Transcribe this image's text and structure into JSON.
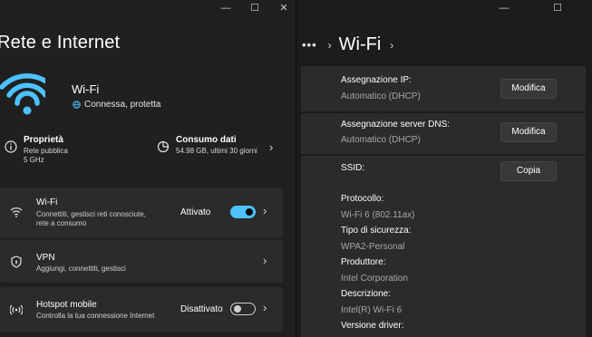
{
  "window_controls": {
    "minimize": "—",
    "maximize": "☐",
    "close": "✕"
  },
  "left": {
    "title": "Rete e Internet",
    "hero": {
      "name": "Wi-Fi",
      "status": "Connessa, protetta",
      "icon": "wifi-icon"
    },
    "properties": {
      "title": "Proprietà",
      "line1": "Rete pubblica",
      "line2": "5 GHz",
      "icon": "info-icon"
    },
    "data_usage": {
      "title": "Consumo dati",
      "subtitle": "54.98 GB, ultimi 30 giorni",
      "icon": "pie-chart-icon"
    },
    "items": [
      {
        "title": "Wi-Fi",
        "desc_line1": "Connettiti, gestisci reti conosciute,",
        "desc_line2": "rete a consumo",
        "state": "Attivato",
        "toggle_on": true,
        "icon": "wifi-icon"
      },
      {
        "title": "VPN",
        "desc_line1": "Aggiungi, connettiti, gestisci",
        "icon": "shield-icon"
      },
      {
        "title": "Hotspot mobile",
        "desc_line1": "Controlla la tua connessione Internet",
        "state": "Disattivato",
        "toggle_on": false,
        "icon": "hotspot-icon"
      }
    ]
  },
  "right": {
    "breadcrumb": {
      "more": "•••",
      "current": "Wi-Fi"
    },
    "ip": {
      "label": "Assegnazione IP:",
      "value": "Automatico (DHCP)",
      "button": "Modifica"
    },
    "dns": {
      "label": "Assegnazione server DNS:",
      "value": "Automatico (DHCP)",
      "button": "Modifica"
    },
    "ssid": {
      "label": "SSID:",
      "button": "Copia"
    },
    "details": [
      {
        "label": "Protocollo:",
        "value": "Wi-Fi 6 (802.11ax)"
      },
      {
        "label": "Tipo di sicurezza:",
        "value": "WPA2-Personal"
      },
      {
        "label": "Produttore:",
        "value": "Intel Corporation"
      },
      {
        "label": "Descrizione:",
        "value": "Intel(R) Wi-Fi 6"
      },
      {
        "label": "Versione driver:"
      }
    ]
  },
  "colors": {
    "accent": "#4cc2ff",
    "background": "#202020",
    "card": "#2b2b2b"
  }
}
